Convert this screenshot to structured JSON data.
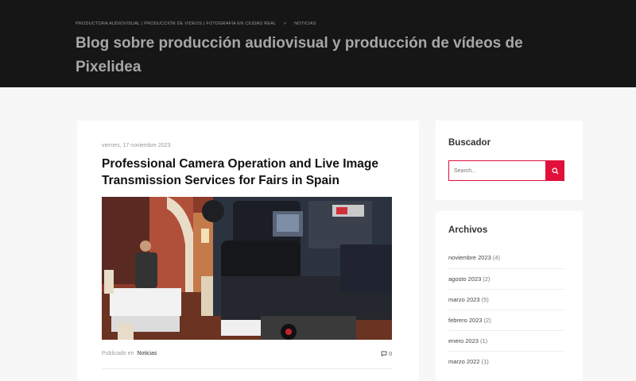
{
  "header": {
    "breadcrumb": {
      "home": "PRODUCTORA AUDIOVISUAL | PRODUCCIÓN DE VIDEOS | FOTOGRAFÍA EN CIUDAD REAL",
      "separator": ">",
      "current": "NOTICIAS"
    },
    "title": "Blog sobre producción audiovisual y producción de vídeos de Pixelidea"
  },
  "post": {
    "date": "viernes, 17 noviembre 2023",
    "title": "Professional Camera Operation and Live Image Transmission Services for Fairs in Spain",
    "published_label": "Publicado en",
    "category": "Noticias",
    "comment_count": "0"
  },
  "sidebar": {
    "search": {
      "title": "Buscador",
      "placeholder": "Search..."
    },
    "archive": {
      "title": "Archivos",
      "items": [
        {
          "label": "noviembre 2023",
          "count": "(4)"
        },
        {
          "label": "agosto 2023",
          "count": "(2)"
        },
        {
          "label": "marzo 2023",
          "count": "(5)"
        },
        {
          "label": "febrero 2023",
          "count": "(2)"
        },
        {
          "label": "enero 2023",
          "count": "(1)"
        },
        {
          "label": "marzo 2022",
          "count": "(1)"
        }
      ]
    }
  },
  "colors": {
    "accent": "#e0103a",
    "header_bg": "#161616",
    "page_bg": "#f7f7f7"
  }
}
